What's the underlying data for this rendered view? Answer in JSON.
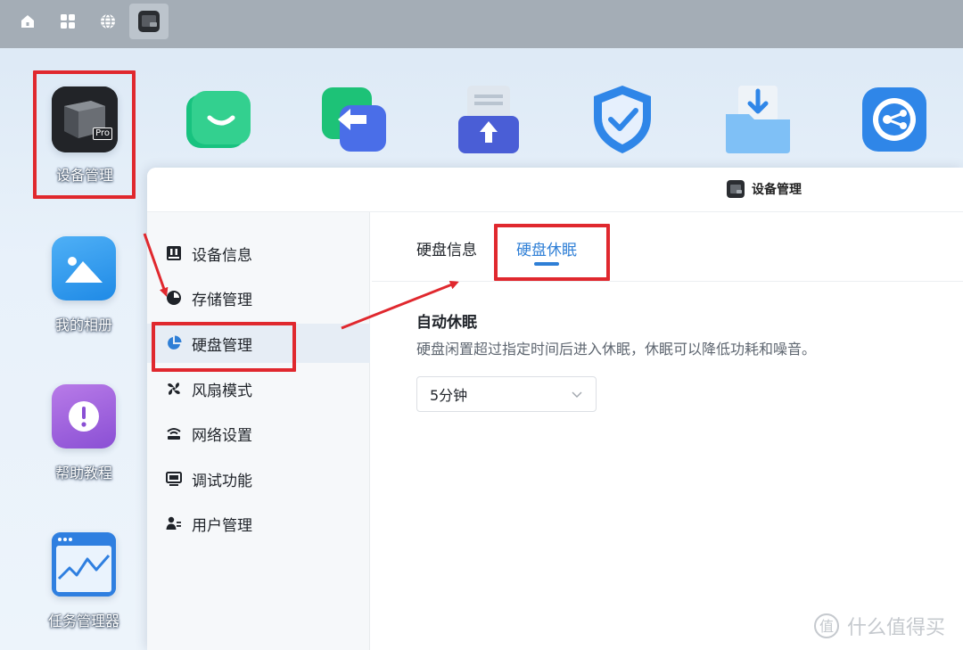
{
  "desktop": {
    "icons": [
      {
        "label": "设备管理"
      },
      {
        "label": "我的相册"
      },
      {
        "label": "帮助教程"
      },
      {
        "label": "任务管理器"
      }
    ],
    "device_icon_badge": "Pro"
  },
  "window": {
    "title": "设备管理"
  },
  "sidebar": {
    "items": [
      {
        "label": "设备信息"
      },
      {
        "label": "存储管理"
      },
      {
        "label": "硬盘管理"
      },
      {
        "label": "风扇模式"
      },
      {
        "label": "网络设置"
      },
      {
        "label": "调试功能"
      },
      {
        "label": "用户管理"
      }
    ],
    "active_index": 2
  },
  "tabs": [
    {
      "label": "硬盘信息"
    },
    {
      "label": "硬盘休眠"
    }
  ],
  "active_tab": 1,
  "auto_sleep": {
    "title": "自动休眠",
    "description": "硬盘闲置超过指定时间后进入休眠，休眠可以降低功耗和噪音。",
    "selected": "5分钟"
  },
  "watermark": {
    "text": "什么值得买"
  },
  "colors": {
    "accent": "#2f7fd6",
    "highlight": "#e0282e",
    "taskbar": "#a4adb6"
  }
}
